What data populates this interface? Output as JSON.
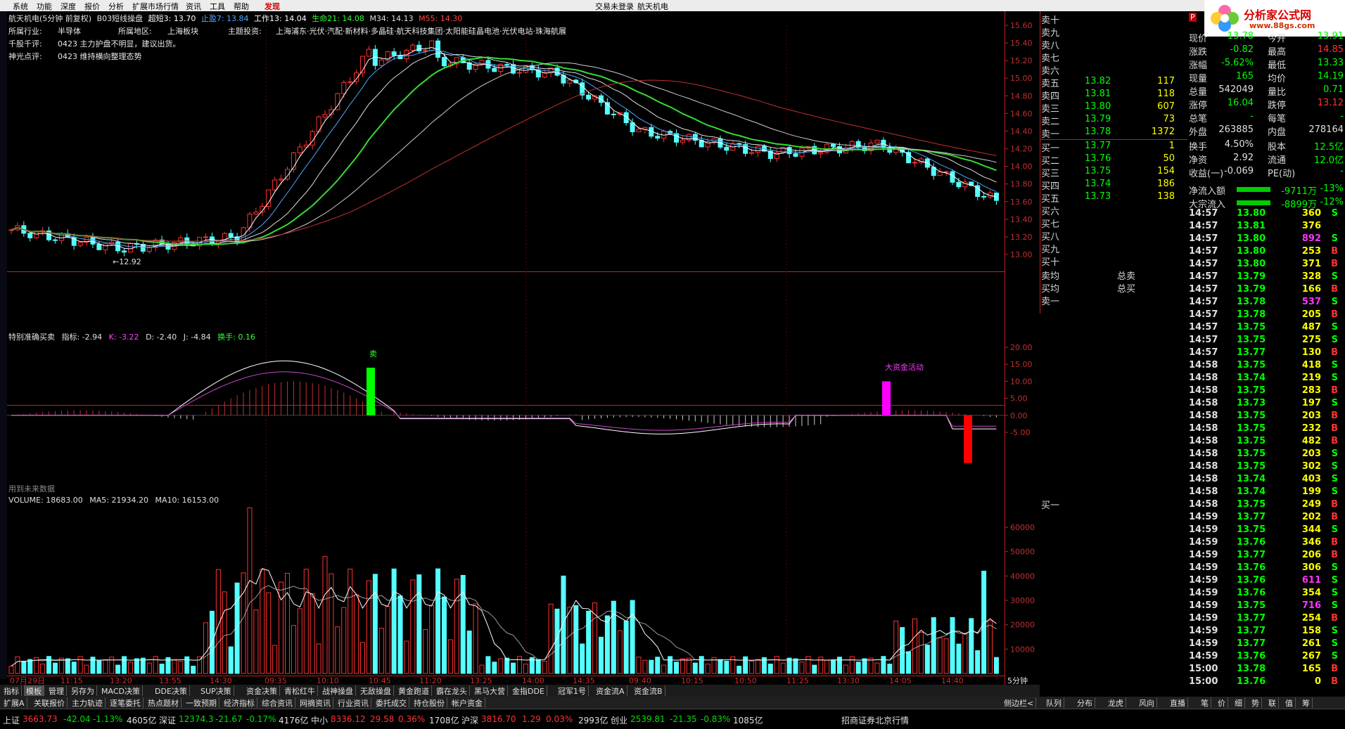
{
  "menu": {
    "items": [
      "系统",
      "功能",
      "深度",
      "报价",
      "分析",
      "扩展市场行情",
      "资讯",
      "工具",
      "帮助"
    ],
    "discover": "发现",
    "center1": "交易未登录",
    "center2": "航天机电"
  },
  "logo": {
    "text": "分析家公式网",
    "url": "www.88gs.com"
  },
  "chart_title": {
    "name": "航天机电(5分钟 前复权)",
    "indicator": "B03短线操盘",
    "cdx": "超短3: 13.70",
    "zy": "止盈7: 13.84",
    "gz": "工作13: 14.04",
    "sm": "生命21: 14.08",
    "m34": "M34: 14.13",
    "m55": "M55: 14.30"
  },
  "info": [
    {
      "label": "所属行业:",
      "value": "半导体",
      "label2": "所属地区:",
      "value2": "上海板块",
      "label3": "主题投资:",
      "value3": "上海浦东·光伏·汽配·新材料·多晶硅·航天科技集团·太阳能硅晶电池·光伏电站·珠海航展"
    },
    {
      "label": "千股千评:",
      "value": "0423 主力护盘不明显，建议出货。"
    },
    {
      "label": "神光点评:",
      "value": "0423 维持横向整理态势"
    }
  ],
  "price_axis": [
    "15.60",
    "15.40",
    "15.20",
    "15.00",
    "14.80",
    "14.60",
    "14.40",
    "14.20",
    "14.00",
    "13.80",
    "13.60",
    "13.40",
    "13.20",
    "13.00"
  ],
  "low_mark": "←12.92",
  "kdj": {
    "title": "特别准确买卖",
    "zb": "指标: -2.94",
    "k": "K: -3.22",
    "d": "D: -2.40",
    "j": "J: -4.84",
    "hs": "换手: 0.16",
    "axis": [
      "20.00",
      "15.00",
      "10.00",
      "5.00",
      "0.00",
      "-5.00"
    ],
    "sell": "卖",
    "big": "大资金活动",
    "future": "用到未来数据"
  },
  "volume": {
    "title": "VOLUME: 18683.00",
    "ma5": "MA5: 21934.20",
    "ma10": "MA10: 16153.00",
    "axis": [
      "60000",
      "50000",
      "40000",
      "30000",
      "20000",
      "10000"
    ]
  },
  "time_axis": [
    "07月29日",
    "11:15",
    "13:20",
    "13:55",
    "14:30",
    "09:35",
    "10:10",
    "10:45",
    "11:20",
    "13:25",
    "14:00",
    "14:35",
    "09:40",
    "10:15",
    "10:50",
    "11:25",
    "13:30",
    "14:05",
    "14:40"
  ],
  "period": "5分钟",
  "orderbook": {
    "sells": [
      {
        "l": "卖十",
        "p": "",
        "q": ""
      },
      {
        "l": "卖九",
        "p": "",
        "q": ""
      },
      {
        "l": "卖八",
        "p": "",
        "q": ""
      },
      {
        "l": "卖七",
        "p": "",
        "q": ""
      },
      {
        "l": "卖六",
        "p": "",
        "q": ""
      },
      {
        "l": "卖五",
        "p": "13.82",
        "q": "117"
      },
      {
        "l": "卖四",
        "p": "13.81",
        "q": "118"
      },
      {
        "l": "卖三",
        "p": "13.80",
        "q": "607"
      },
      {
        "l": "卖二",
        "p": "13.79",
        "q": "73"
      },
      {
        "l": "卖一",
        "p": "13.78",
        "q": "1372"
      }
    ],
    "buys": [
      {
        "l": "买一",
        "p": "13.77",
        "q": "1"
      },
      {
        "l": "买二",
        "p": "13.76",
        "q": "50"
      },
      {
        "l": "买三",
        "p": "13.75",
        "q": "154"
      },
      {
        "l": "买四",
        "p": "13.74",
        "q": "186"
      },
      {
        "l": "买五",
        "p": "13.73",
        "q": "138"
      },
      {
        "l": "买六",
        "p": "",
        "q": ""
      },
      {
        "l": "买七",
        "p": "",
        "q": ""
      },
      {
        "l": "买八",
        "p": "",
        "q": ""
      },
      {
        "l": "买九",
        "p": "",
        "q": ""
      },
      {
        "l": "买十",
        "p": "",
        "q": ""
      }
    ],
    "avg_sell": "卖均",
    "avg_buy": "买均",
    "total_sell": "总卖",
    "total_buy": "总买",
    "s1": "卖一",
    "b1": "买一"
  },
  "quote": {
    "p_badge": "P",
    "rows": [
      {
        "l1": "现价",
        "v1": "13.78",
        "l2": "今开",
        "v2": "13.91"
      },
      {
        "l1": "涨跌",
        "v1": "-0.82",
        "l2": "最高",
        "v2": "14.85"
      },
      {
        "l1": "涨幅",
        "v1": "-5.62%",
        "l2": "最低",
        "v2": "13.33"
      },
      {
        "l1": "现量",
        "v1": "165",
        "l2": "均价",
        "v2": "14.19"
      },
      {
        "l1": "总量",
        "v1": "542049",
        "l2": "量比",
        "v2": "0.71"
      },
      {
        "l1": "涨停",
        "v1": "16.04",
        "l2": "跌停",
        "v2": "13.12"
      },
      {
        "l1": "总笔",
        "v1": "-",
        "l2": "每笔",
        "v2": "-"
      },
      {
        "l1": "外盘",
        "v1": "263885",
        "l2": "内盘",
        "v2": "278164"
      },
      {
        "l1": "换手",
        "v1": "4.50%",
        "l2": "股本",
        "v2": "12.5亿"
      },
      {
        "l1": "净资",
        "v1": "2.92",
        "l2": "流通",
        "v2": "12.0亿"
      },
      {
        "l1": "收益(一)",
        "v1": "-0.069",
        "l2": "PE(动)",
        "v2": "-"
      }
    ],
    "flow1": {
      "l": "净流入额",
      "v": "-9711万",
      "p": "-13%"
    },
    "flow2": {
      "l": "大宗流入",
      "v": "-8899万",
      "p": "-12%"
    }
  },
  "ticks": [
    [
      "14:57",
      "13.80",
      "360",
      "S"
    ],
    [
      "14:57",
      "13.81",
      "376",
      ""
    ],
    [
      "14:57",
      "13.80",
      "892",
      "S"
    ],
    [
      "14:57",
      "13.80",
      "253",
      "B"
    ],
    [
      "14:57",
      "13.80",
      "371",
      "B"
    ],
    [
      "14:57",
      "13.79",
      "328",
      "S"
    ],
    [
      "14:57",
      "13.79",
      "166",
      "B"
    ],
    [
      "14:57",
      "13.78",
      "537",
      "S"
    ],
    [
      "14:57",
      "13.78",
      "205",
      "B"
    ],
    [
      "14:57",
      "13.75",
      "487",
      "S"
    ],
    [
      "14:57",
      "13.75",
      "275",
      "S"
    ],
    [
      "14:57",
      "13.77",
      "130",
      "B"
    ],
    [
      "14:58",
      "13.75",
      "418",
      "S"
    ],
    [
      "14:58",
      "13.74",
      "219",
      "S"
    ],
    [
      "14:58",
      "13.75",
      "283",
      "B"
    ],
    [
      "14:58",
      "13.73",
      "197",
      "S"
    ],
    [
      "14:58",
      "13.75",
      "203",
      "B"
    ],
    [
      "14:58",
      "13.75",
      "232",
      "B"
    ],
    [
      "14:58",
      "13.75",
      "482",
      "B"
    ],
    [
      "14:58",
      "13.75",
      "203",
      "S"
    ],
    [
      "14:58",
      "13.75",
      "302",
      "S"
    ],
    [
      "14:58",
      "13.74",
      "403",
      "S"
    ],
    [
      "14:58",
      "13.74",
      "199",
      "S"
    ],
    [
      "14:58",
      "13.75",
      "249",
      "B"
    ],
    [
      "14:59",
      "13.77",
      "202",
      "B"
    ],
    [
      "14:59",
      "13.75",
      "344",
      "S"
    ],
    [
      "14:59",
      "13.76",
      "346",
      "B"
    ],
    [
      "14:59",
      "13.77",
      "206",
      "B"
    ],
    [
      "14:59",
      "13.76",
      "306",
      "S"
    ],
    [
      "14:59",
      "13.76",
      "611",
      "S"
    ],
    [
      "14:59",
      "13.76",
      "354",
      "S"
    ],
    [
      "14:59",
      "13.75",
      "716",
      "S"
    ],
    [
      "14:59",
      "13.77",
      "254",
      "B"
    ],
    [
      "14:59",
      "13.77",
      "158",
      "S"
    ],
    [
      "14:59",
      "13.77",
      "261",
      "S"
    ],
    [
      "14:59",
      "13.76",
      "267",
      "S"
    ],
    [
      "15:00",
      "13.78",
      "165",
      "B"
    ],
    [
      "15:00",
      "13.76",
      "0",
      "B"
    ]
  ],
  "tabs": [
    "指标",
    "模板",
    "管理",
    "另存为",
    "MACD决策",
    "DDE决策",
    "SUP决策",
    "资金决策",
    "青松红牛",
    "战神操盘",
    "无敌操盘",
    "黄金跑道",
    "霸在龙头",
    "黑马大营",
    "金指DDE",
    "冠军1号",
    "资金流A",
    "资金流B"
  ],
  "tabs2": [
    "扩展A",
    "关联报价",
    "主力轨迹",
    "逐笔委托",
    "热点题材",
    "一致预期",
    "经济指标",
    "综合资讯",
    "网摘资讯",
    "行业资讯",
    "委托成交",
    "持仓股份",
    "帐户资金"
  ],
  "side_label": "侧边栏<",
  "rtabs": [
    "队列",
    "分布",
    "龙虎",
    "风向",
    "直播",
    "笔",
    "价",
    "细",
    "势",
    "联",
    "值",
    "筹"
  ],
  "status": {
    "sh": "上证",
    "sh_v": "3663.73",
    "sh_c": "-42.04",
    "sh_p": "-1.13%",
    "sh_a": "4605亿",
    "sz": "深证",
    "sz_v": "12374.3",
    "sz_c": "-21.67",
    "sz_p": "-0.17%",
    "sz_a": "4176亿",
    "zx": "中小",
    "zx_v": "8336.12",
    "zx_c": "29.58",
    "zx_p": "0.36%",
    "zx_a": "1708亿",
    "hs": "沪深",
    "hs_v": "3816.70",
    "hs_c": "1.29",
    "hs_p": "0.03%",
    "hs_a": "2993亿",
    "cy": "创业",
    "cy_v": "2539.81",
    "cy_c": "-21.35",
    "cy_p": "-0.83%",
    "cy_a": "1085亿",
    "broker": "招商证券北京行情"
  }
}
